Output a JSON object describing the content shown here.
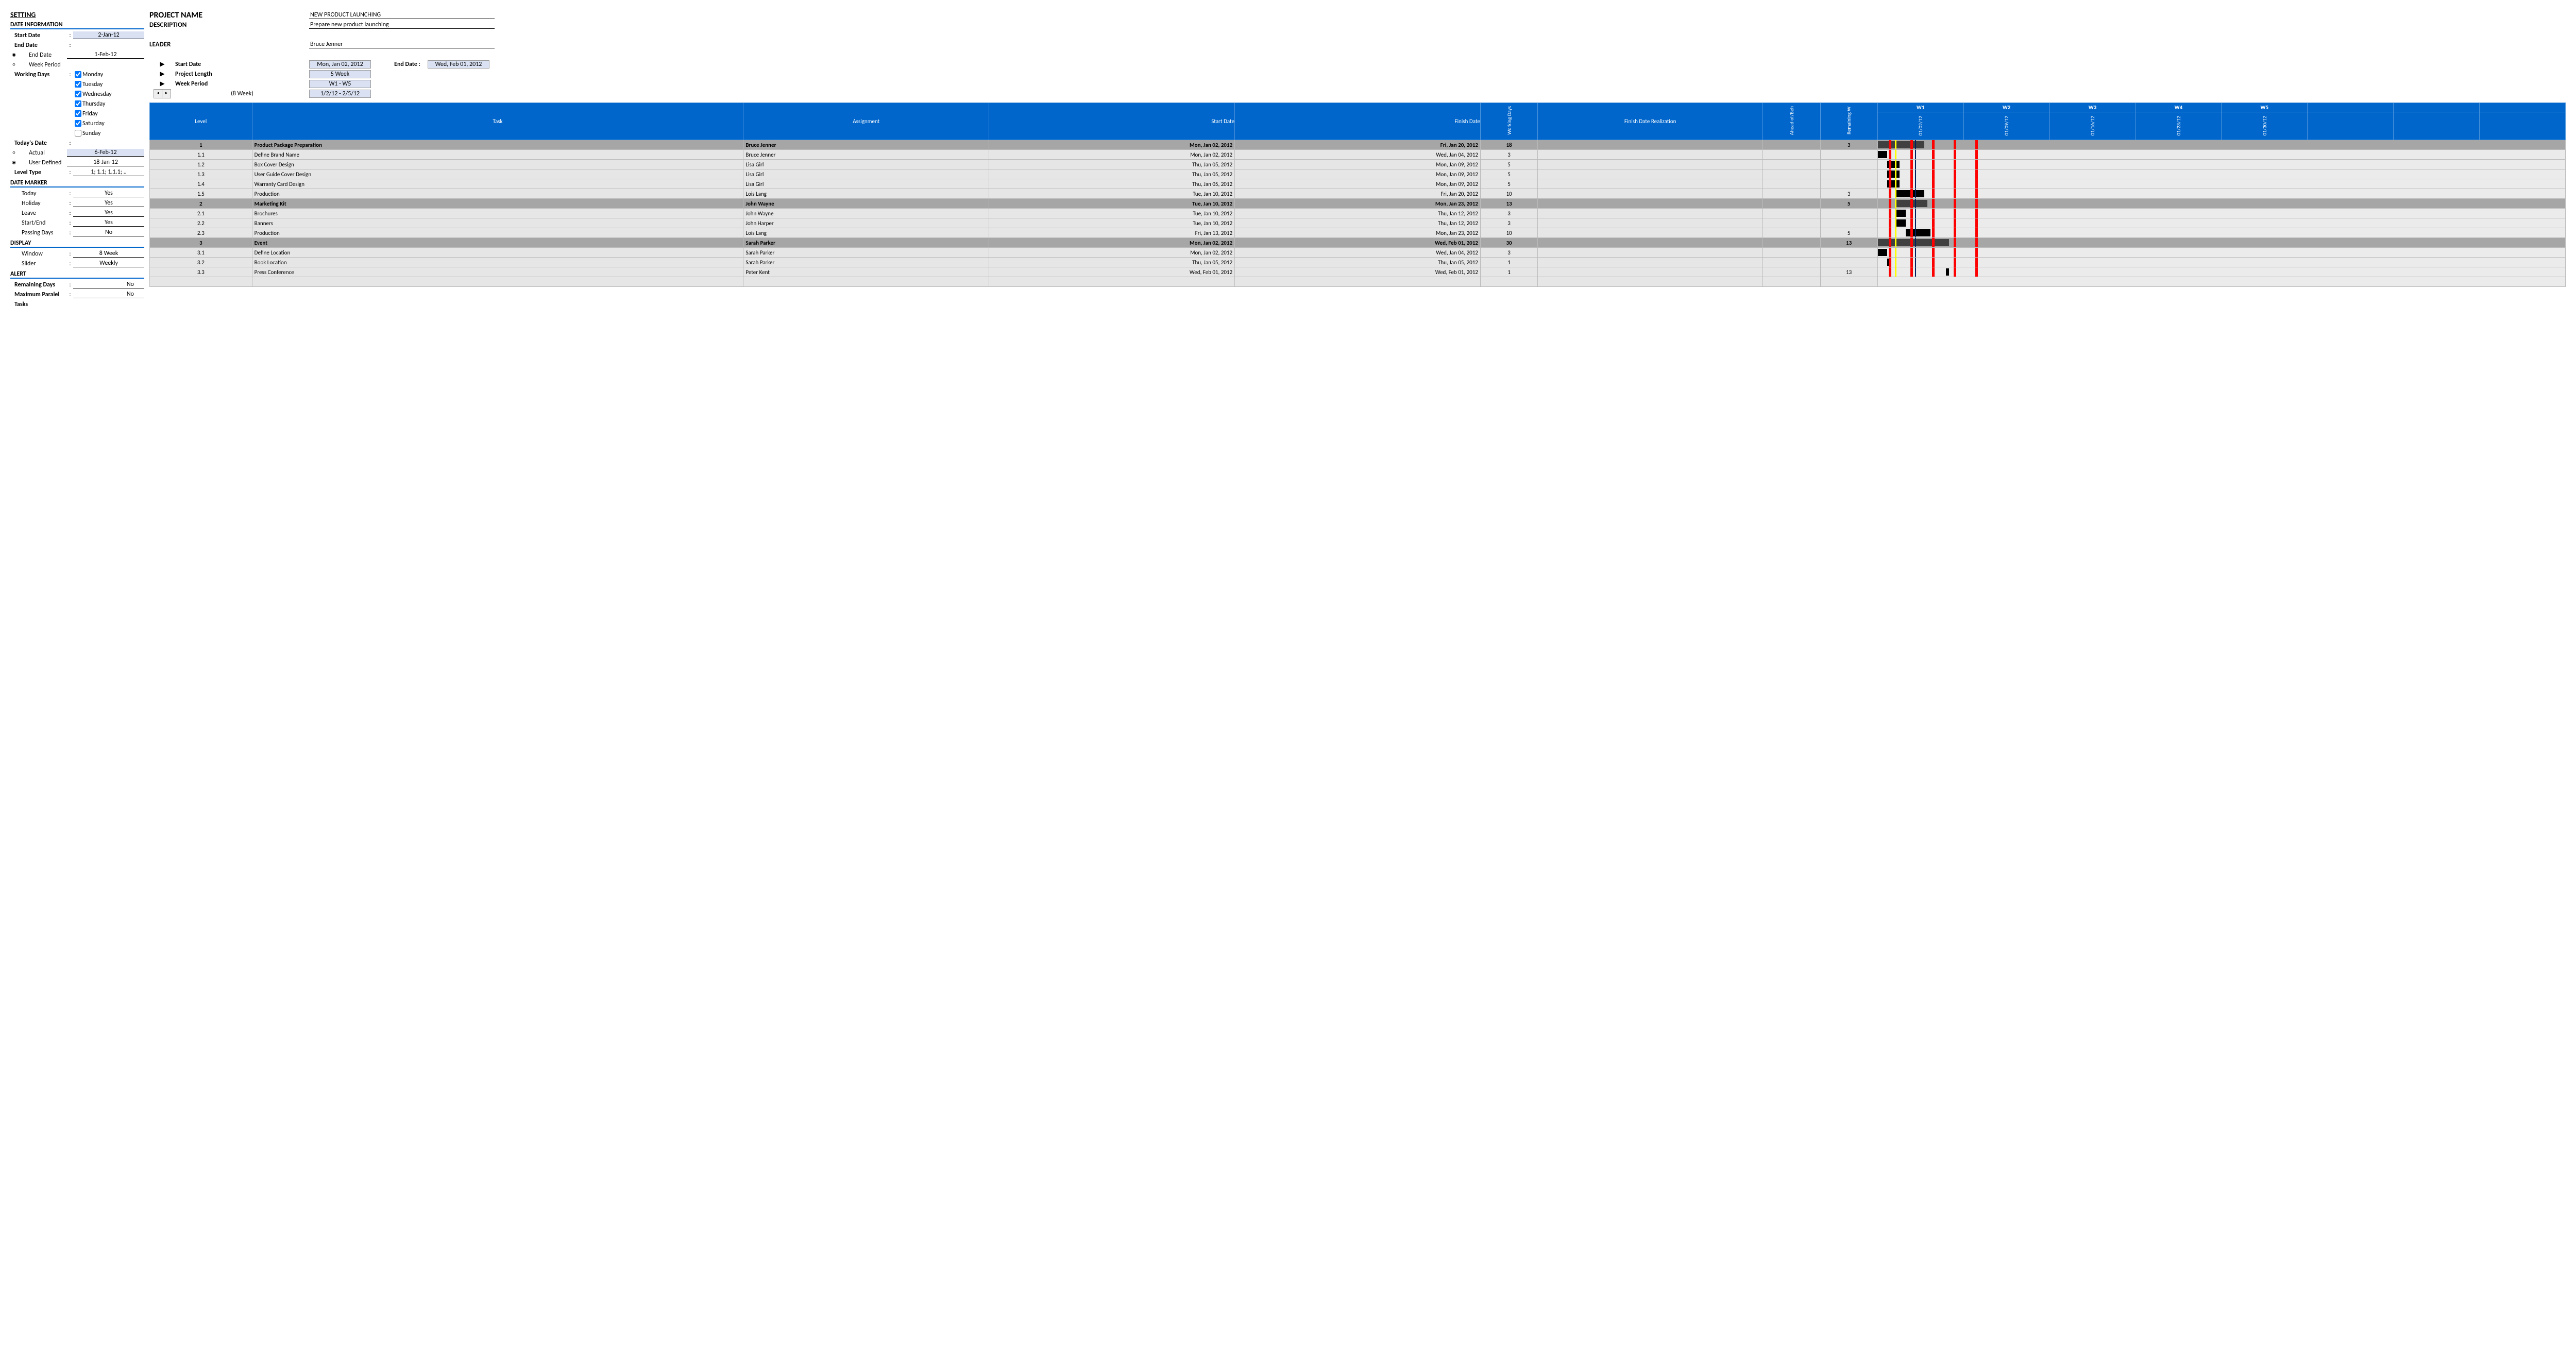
{
  "setting": {
    "title": "SETTING",
    "date_info": "DATE INFORMATION",
    "start_date_lbl": "Start Date",
    "start_date": "2-Jan-12",
    "end_date_lbl": "End Date",
    "end_date_opt": "End Date",
    "end_date_val": "1-Feb-12",
    "week_period_opt": "Week Period",
    "working_days_lbl": "Working Days",
    "days": [
      "Monday",
      "Tuesday",
      "Wednesday",
      "Thursday",
      "Friday",
      "Saturday",
      "Sunday"
    ],
    "days_checked": [
      true,
      true,
      true,
      true,
      true,
      true,
      false
    ],
    "todays_date_lbl": "Today's Date",
    "actual_opt": "Actual",
    "actual_val": "6-Feb-12",
    "user_def_opt": "User Defined",
    "user_def_val": "18-Jan-12",
    "level_type_lbl": "Level Type",
    "level_type_val": "1; 1.1; 1.1.1; ..",
    "date_marker": "DATE MARKER",
    "today_lbl": "Today",
    "today_val": "Yes",
    "holiday_lbl": "Holiday",
    "holiday_val": "Yes",
    "leave_lbl": "Leave",
    "leave_val": "Yes",
    "startend_lbl": "Start/End",
    "startend_val": "Yes",
    "passing_lbl": "Passing Days",
    "passing_val": "No",
    "display": "DISPLAY",
    "window_lbl": "Window",
    "window_val": "8 Week",
    "slider_lbl": "Slider",
    "slider_val": "Weekly",
    "alert": "ALERT",
    "remaining_lbl": "Remaining Days",
    "remaining_val": "No",
    "maxpar_lbl": "Maximum Paralel",
    "maxpar_val": "No",
    "tasks_lbl": "Tasks"
  },
  "project": {
    "name_lbl": "PROJECT NAME",
    "name": "NEW PRODUCT LAUNCHING",
    "desc_lbl": "DESCRIPTION",
    "desc": "Prepare new product launching",
    "leader_lbl": "LEADER",
    "leader": "Bruce Jenner",
    "start_lbl": "Start Date",
    "start": "Mon, Jan 02, 2012",
    "end_lbl": "End Date :",
    "end": "Wed, Feb 01, 2012",
    "length_lbl": "Project Length",
    "length": "5 Week",
    "period_lbl": "Week Period",
    "period": "W1 - W5",
    "window_lbl": "(8 Week)",
    "window_range": "1/2/12 - 2/5/12"
  },
  "headers": {
    "level": "Level",
    "task": "Task",
    "assignment": "Assignment",
    "start": "Start Date",
    "finish": "Finish Date",
    "wd": "Working Days",
    "fdr": "Finish Date Realization",
    "ab": "Ahead of/Beh",
    "rw": "Remaining W",
    "weeks": [
      "W1",
      "W2",
      "W3",
      "W4",
      "W5"
    ],
    "dates": [
      "01/02/12",
      "01/09/12",
      "01/16/12",
      "01/23/12",
      "01/30/12"
    ]
  },
  "rows": [
    {
      "level": "1",
      "task": "Product Package Preparation",
      "assign": "Bruce Jenner",
      "start": "Mon, Jan 02, 2012",
      "finish": "Fri, Jan 20, 2012",
      "wd": "18",
      "rw": "3",
      "parent": true,
      "bar_start": 0,
      "bar_len": 15
    },
    {
      "level": "1.1",
      "task": "Define Brand Name",
      "assign": "Bruce Jenner",
      "start": "Mon, Jan 02, 2012",
      "finish": "Wed, Jan 04, 2012",
      "wd": "3",
      "rw": "",
      "parent": false,
      "bar_start": 0,
      "bar_len": 3
    },
    {
      "level": "1.2",
      "task": "Box Cover Design",
      "assign": "Lisa Girl",
      "start": "Thu, Jan 05, 2012",
      "finish": "Mon, Jan 09, 2012",
      "wd": "5",
      "rw": "",
      "parent": false,
      "bar_start": 3,
      "bar_len": 4
    },
    {
      "level": "1.3",
      "task": "User Guide Cover Design",
      "assign": "Lisa Girl",
      "start": "Thu, Jan 05, 2012",
      "finish": "Mon, Jan 09, 2012",
      "wd": "5",
      "rw": "",
      "parent": false,
      "bar_start": 3,
      "bar_len": 4
    },
    {
      "level": "1.4",
      "task": "Warranty Card Design",
      "assign": "Lisa Girl",
      "start": "Thu, Jan 05, 2012",
      "finish": "Mon, Jan 09, 2012",
      "wd": "5",
      "rw": "",
      "parent": false,
      "bar_start": 3,
      "bar_len": 4
    },
    {
      "level": "1.5",
      "task": "Production",
      "assign": "Lois Lang",
      "start": "Tue, Jan 10, 2012",
      "finish": "Fri, Jan 20, 2012",
      "wd": "10",
      "rw": "3",
      "parent": false,
      "bar_start": 6,
      "bar_len": 9
    },
    {
      "level": "2",
      "task": "Marketing Kit",
      "assign": "John Wayne",
      "start": "Tue, Jan 10, 2012",
      "finish": "Mon, Jan 23, 2012",
      "wd": "13",
      "rw": "5",
      "parent": true,
      "bar_start": 6,
      "bar_len": 10
    },
    {
      "level": "2.1",
      "task": "Brochures",
      "assign": "John Wayne",
      "start": "Tue, Jan 10, 2012",
      "finish": "Thu, Jan 12, 2012",
      "wd": "3",
      "rw": "",
      "parent": false,
      "bar_start": 6,
      "bar_len": 3
    },
    {
      "level": "2.2",
      "task": "Banners",
      "assign": "John Harper",
      "start": "Tue, Jan 10, 2012",
      "finish": "Thu, Jan 12, 2012",
      "wd": "3",
      "rw": "",
      "parent": false,
      "bar_start": 6,
      "bar_len": 3
    },
    {
      "level": "2.3",
      "task": "Production",
      "assign": "Lois Lang",
      "start": "Fri, Jan 13, 2012",
      "finish": "Mon, Jan 23, 2012",
      "wd": "10",
      "rw": "5",
      "parent": false,
      "bar_start": 9,
      "bar_len": 8
    },
    {
      "level": "3",
      "task": "Event",
      "assign": "Sarah Parker",
      "start": "Mon, Jan 02, 2012",
      "finish": "Wed, Feb 01, 2012",
      "wd": "30",
      "rw": "13",
      "parent": true,
      "bar_start": 0,
      "bar_len": 23
    },
    {
      "level": "3.1",
      "task": "Define Location",
      "assign": "Sarah Parker",
      "start": "Mon, Jan 02, 2012",
      "finish": "Wed, Jan 04, 2012",
      "wd": "3",
      "rw": "",
      "parent": false,
      "bar_start": 0,
      "bar_len": 3
    },
    {
      "level": "3.2",
      "task": "Book Location",
      "assign": "Sarah Parker",
      "start": "Thu, Jan 05, 2012",
      "finish": "Thu, Jan 05, 2012",
      "wd": "1",
      "rw": "",
      "parent": false,
      "bar_start": 3,
      "bar_len": 1
    },
    {
      "level": "3.3",
      "task": "Press Conference",
      "assign": "Peter Kent",
      "start": "Wed, Feb 01, 2012",
      "finish": "Wed, Feb 01, 2012",
      "wd": "1",
      "rw": "13",
      "parent": false,
      "bar_start": 22,
      "bar_len": 1
    }
  ],
  "chart": {
    "days_per_week": 7,
    "weeks_visible": 8,
    "today_col": 12,
    "red_markers": [
      3.5,
      10.5,
      17.5,
      24.5,
      31.5
    ],
    "yellow_marker": 5.5,
    "blue_marker": 6.5
  }
}
